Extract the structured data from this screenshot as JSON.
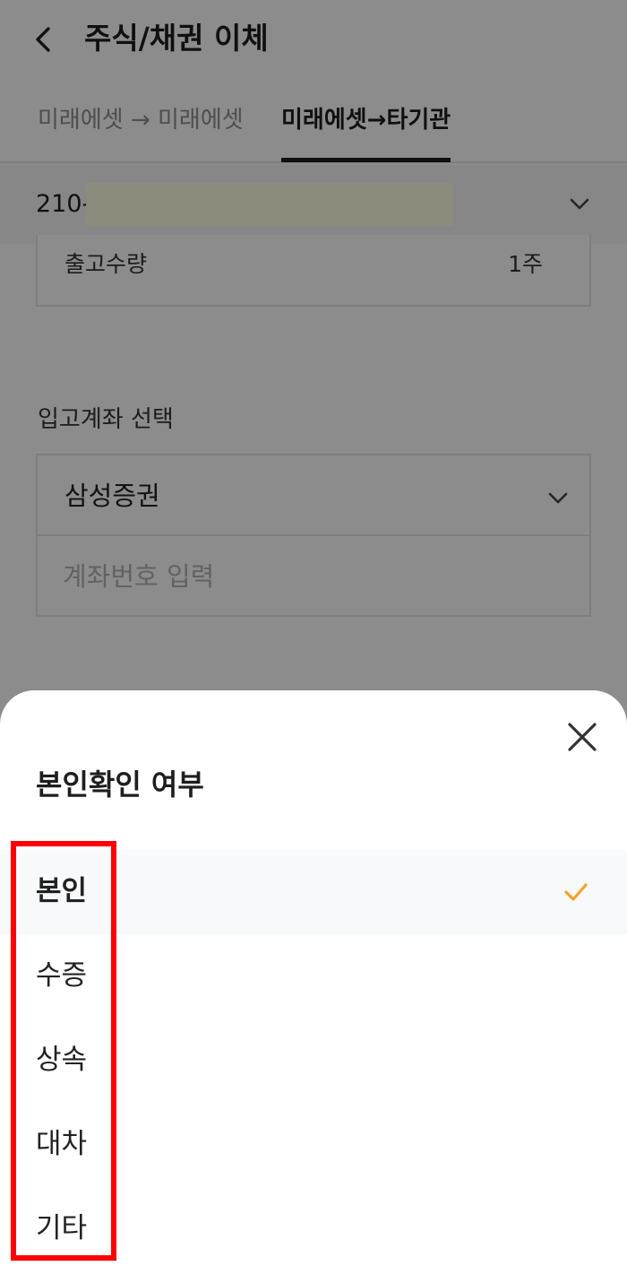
{
  "header": {
    "title": "주식/채권 이체",
    "back_icon": "chevron-left-icon"
  },
  "tabs": [
    {
      "label": "미래에셋 → 미래에셋",
      "active": false
    },
    {
      "label": "미래에셋→타기관",
      "active": true
    }
  ],
  "account": {
    "prefix": "210-",
    "dropdown_icon": "chevron-down-icon"
  },
  "quantity": {
    "label": "출고수량",
    "value": "1주"
  },
  "deposit_account": {
    "section_label": "입고계좌 선택",
    "broker": "삼성증권",
    "account_placeholder": "계좌번호 입력",
    "account_value": ""
  },
  "sheet": {
    "title": "본인확인 여부",
    "close_icon": "close-icon",
    "check_icon": "check-icon",
    "check_color": "#f2a42a",
    "highlight_color": "#ff0000",
    "options": [
      {
        "label": "본인",
        "selected": true
      },
      {
        "label": "수증",
        "selected": false
      },
      {
        "label": "상속",
        "selected": false
      },
      {
        "label": "대차",
        "selected": false
      },
      {
        "label": "기타",
        "selected": false
      }
    ]
  }
}
